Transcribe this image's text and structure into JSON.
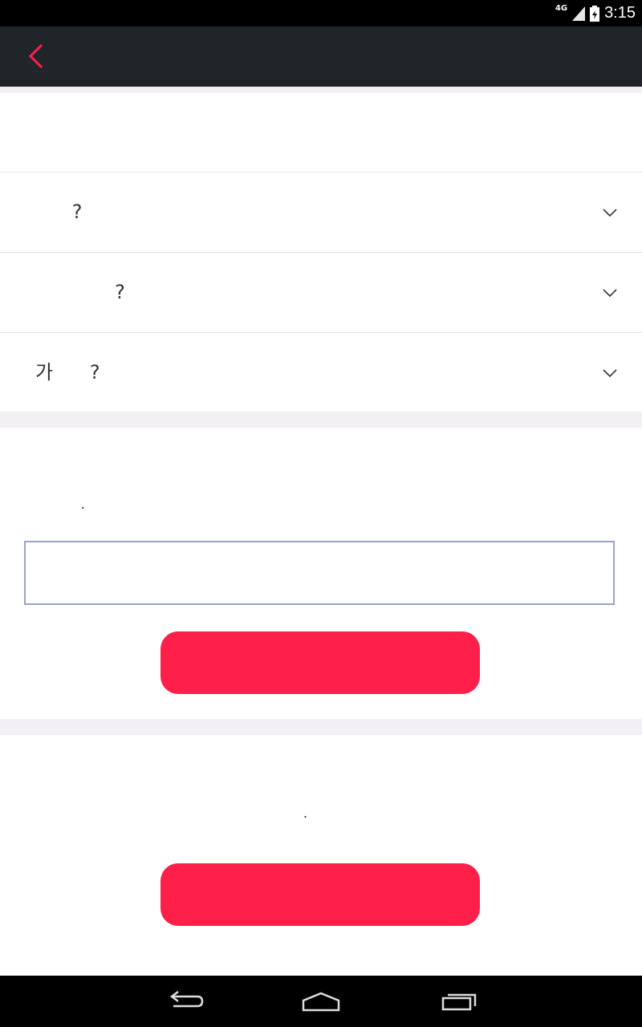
{
  "status_bar": {
    "network": "4G",
    "time": "3:15"
  },
  "faq": {
    "items": [
      {
        "question": "      ?"
      },
      {
        "question": "             ?"
      },
      {
        "question": "가      ?"
      }
    ]
  },
  "inquiry": {
    "message": "        .",
    "input_value": "",
    "input_placeholder": "",
    "submit_label": ""
  },
  "bottom_section": {
    "message": ".",
    "button_label": ""
  },
  "colors": {
    "accent": "#ff1f4b",
    "app_bar": "#212529",
    "divider": "#f3eff5"
  }
}
